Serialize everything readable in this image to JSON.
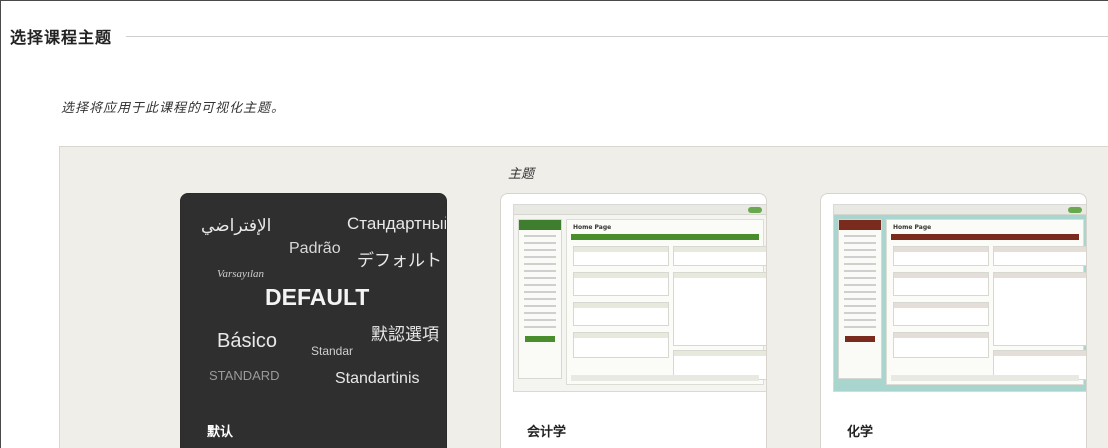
{
  "section": {
    "title": "选择课程主题",
    "instructions": "选择将应用于此课程的可视化主题。"
  },
  "picker": {
    "label": "主题"
  },
  "themes": [
    {
      "name": "默认",
      "words": {
        "w1": "الإفتراضي",
        "w2": "Стандартный",
        "w3": "Padrão",
        "w4": "デフォルト",
        "w5": "Varsayılan",
        "w6": "DEFAULT",
        "w7": "默認選項",
        "w8": "Básico",
        "w9": "Standar",
        "w10": "STANDARD",
        "w11": "Standartinis"
      }
    },
    {
      "name": "会计学",
      "thumb_title": "Home Page"
    },
    {
      "name": "化学",
      "thumb_title": "Home Page"
    }
  ],
  "colors": {
    "default_card": "#2f2f2f",
    "accounting_accent": "#4a8d2c",
    "chemistry_accent": "#7a2b1e",
    "chemistry_bg": "#a9d5cf"
  }
}
